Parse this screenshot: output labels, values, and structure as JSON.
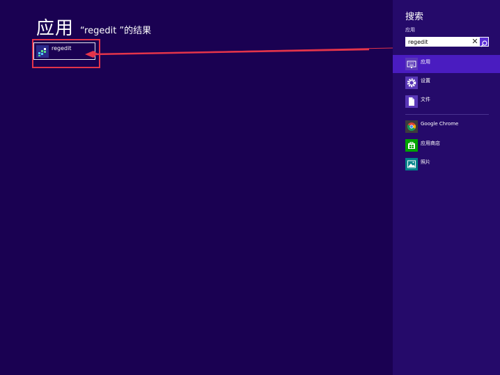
{
  "main": {
    "title": "应用",
    "query_title": "“regedit ”的结果",
    "results": [
      {
        "label": "regedit",
        "icon": "registry-editor-icon"
      }
    ]
  },
  "charm": {
    "title": "搜索",
    "scope_label": "应用",
    "search": {
      "value": "regedit",
      "placeholder": ""
    },
    "scopes": [
      {
        "label": "应用",
        "icon": "keyboard-icon",
        "active": true
      },
      {
        "label": "设置",
        "icon": "gear-icon",
        "active": false
      },
      {
        "label": "文件",
        "icon": "document-icon",
        "active": false
      }
    ],
    "apps": [
      {
        "label": "Google Chrome",
        "icon": "chrome-icon"
      },
      {
        "label": "应用商店",
        "icon": "store-icon"
      },
      {
        "label": "照片",
        "icon": "photos-icon"
      }
    ]
  },
  "colors": {
    "background": "#1a0152",
    "charm_background": "#250a6a",
    "active_scope": "#4a1cc0",
    "annotation": "#e4344a"
  }
}
